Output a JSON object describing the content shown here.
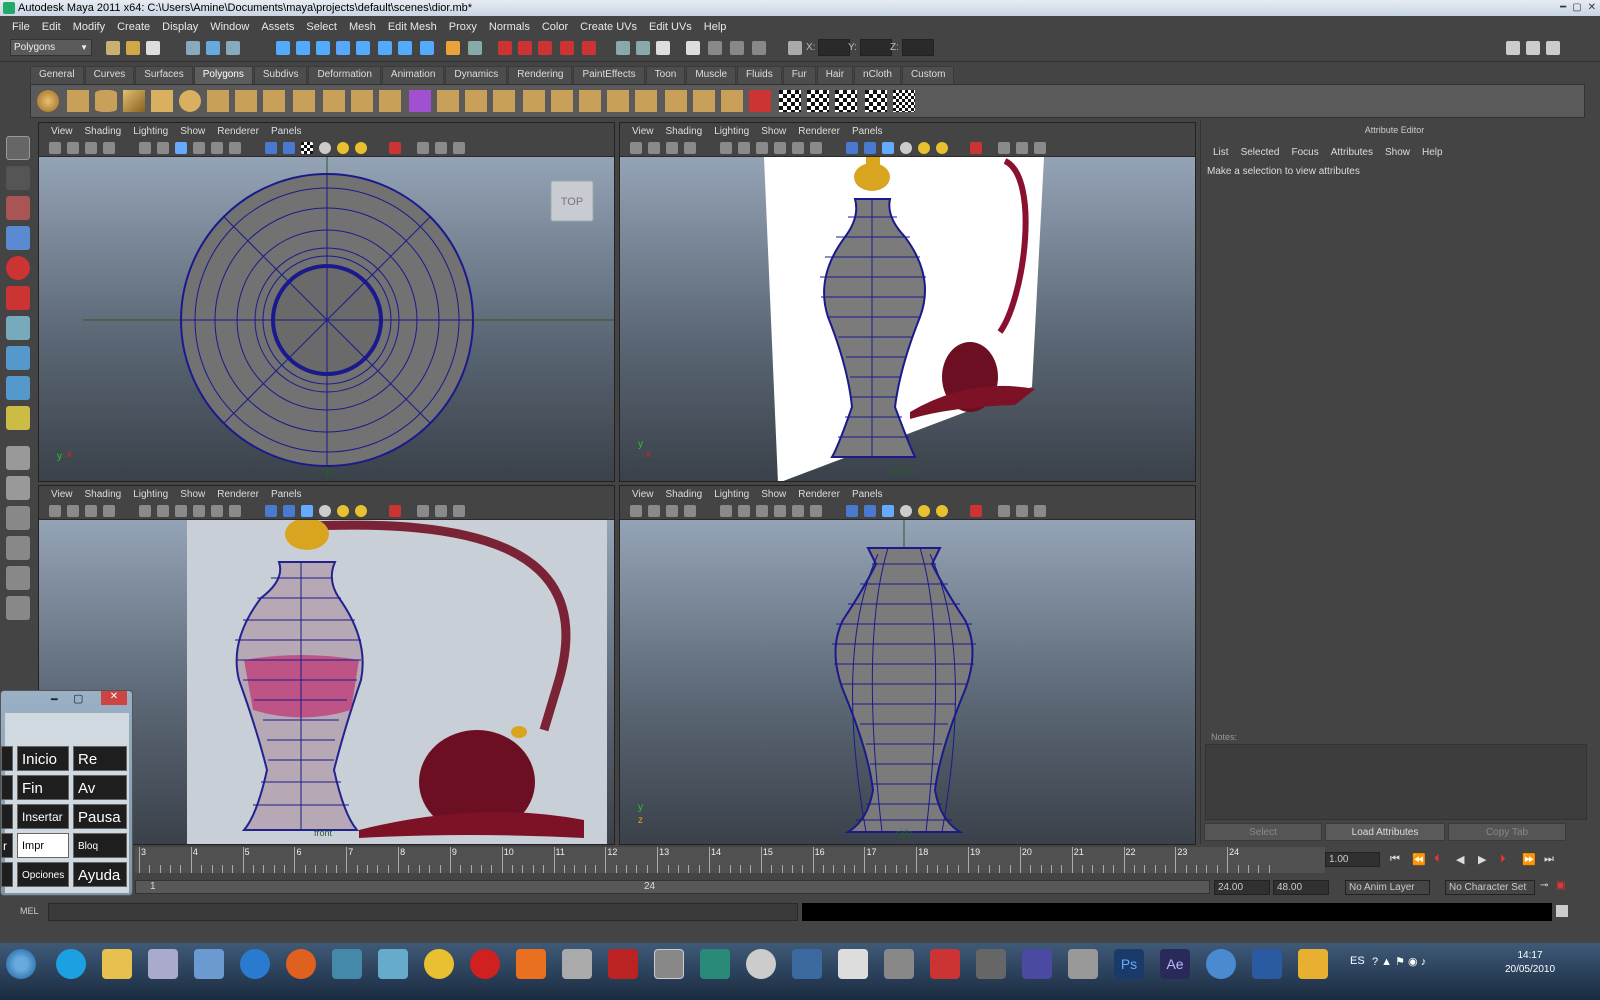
{
  "window": {
    "title": "Autodesk Maya 2011 x64: C:\\Users\\Amine\\Documents\\maya\\projects\\default\\scenes\\dior.mb*"
  },
  "menus": [
    "File",
    "Edit",
    "Modify",
    "Create",
    "Display",
    "Window",
    "Assets",
    "Select",
    "Mesh",
    "Edit Mesh",
    "Proxy",
    "Normals",
    "Color",
    "Create UVs",
    "Edit UVs",
    "Help"
  ],
  "status_line": {
    "menuset": "Polygons",
    "x_label": "X:",
    "y_label": "Y:",
    "z_label": "Z:"
  },
  "shelf_tabs": [
    "General",
    "Curves",
    "Surfaces",
    "Polygons",
    "Subdivs",
    "Deformation",
    "Animation",
    "Dynamics",
    "Rendering",
    "PaintEffects",
    "Toon",
    "Muscle",
    "Fluids",
    "Fur",
    "Hair",
    "nCloth",
    "Custom"
  ],
  "active_shelf": "Polygons",
  "viewport_menu": [
    "View",
    "Shading",
    "Lighting",
    "Show",
    "Renderer",
    "Panels"
  ],
  "viewports": {
    "top": {
      "camera_label": "top",
      "viewcube": "TOP"
    },
    "persp": {
      "camera_label": "persp"
    },
    "front": {
      "camera_label": "front"
    },
    "side": {
      "camera_label": "side"
    }
  },
  "attribute_editor": {
    "title": "Attribute Editor",
    "menu": [
      "List",
      "Selected",
      "Focus",
      "Attributes",
      "Show",
      "Help"
    ],
    "message": "Make a selection to view attributes",
    "notes_label": "Notes:",
    "buttons": {
      "select": "Select",
      "load": "Load Attributes",
      "copy": "Copy Tab"
    }
  },
  "timeline": {
    "ticks": [
      "3",
      "4",
      "5",
      "6",
      "7",
      "8",
      "9",
      "10",
      "11",
      "12",
      "13",
      "14",
      "15",
      "16",
      "17",
      "18",
      "19",
      "20",
      "21",
      "22",
      "23",
      "24"
    ],
    "current_frame": "1.00"
  },
  "range": {
    "start": "1",
    "end": "24",
    "anim_end": "24.00",
    "max": "48.00",
    "anim_layer": "No Anim Layer",
    "char_set": "No Character Set"
  },
  "command_line": {
    "label": "MEL"
  },
  "on_screen_keyboard": {
    "keys": [
      "Inicio",
      "Re Pág",
      "Fin",
      "Av Pág",
      "Insertar",
      "Pausa",
      "Impr Pant",
      "Bloq Despl",
      "Opciones",
      "Ayuda"
    ],
    "edge": "r"
  },
  "taskbar": {
    "language": "ES",
    "time": "14:17",
    "date": "20/05/2010"
  },
  "colors": {
    "accent": "#2ea4e4",
    "wire": "#1a1a8c",
    "vase_base": "#7b7b7b",
    "perfume_red": "#7d1226"
  }
}
